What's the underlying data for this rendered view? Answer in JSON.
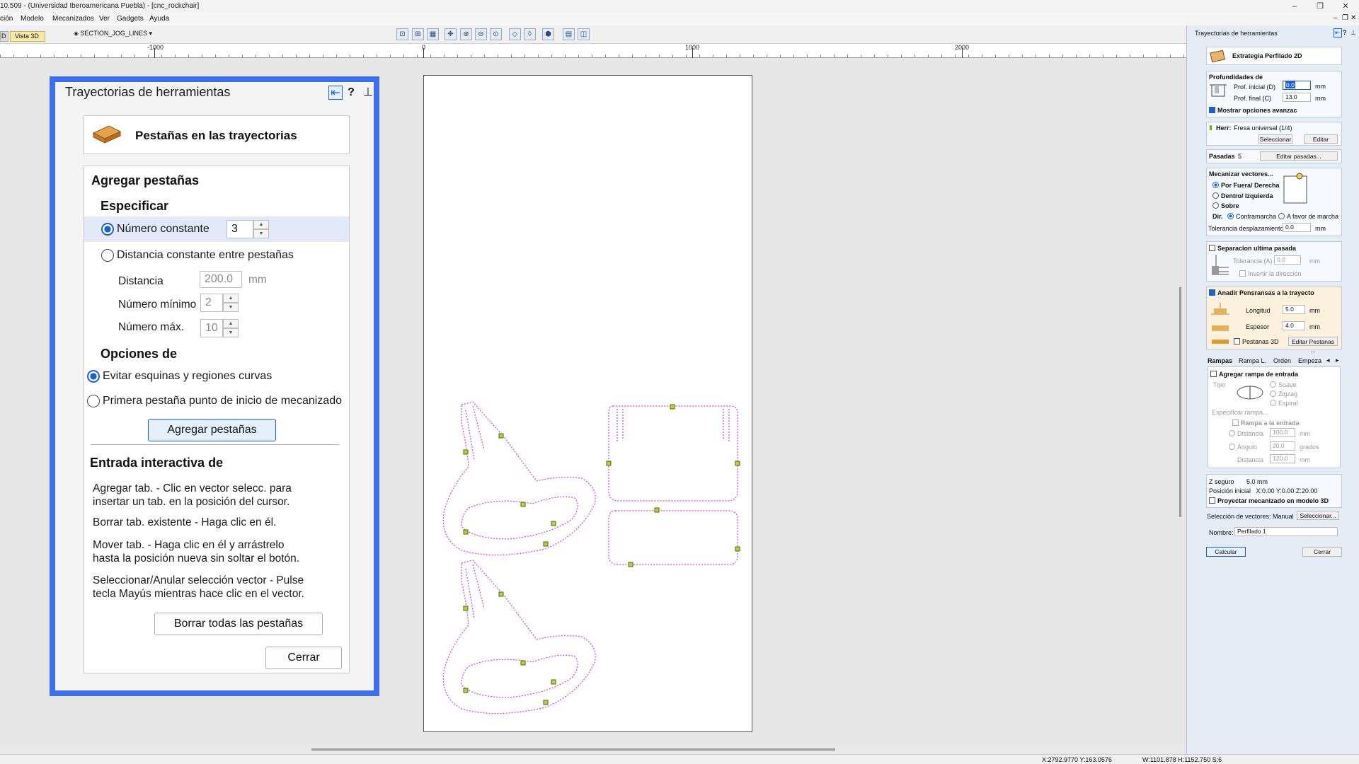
{
  "window": {
    "title": "10.509 - (Universidad Iberoamericana Puebla) - [cnc_rockchair]",
    "controls": [
      "–",
      "❐",
      "✕"
    ],
    "sub_controls": [
      "–",
      "❐",
      "✕"
    ]
  },
  "menu": [
    "ción",
    "Modelo",
    "Mecanizados",
    "Ver",
    "Gadgets",
    "Ayuda"
  ],
  "tabs": {
    "tab_d": "D",
    "vista3d": "Vista 3D"
  },
  "layer": "SECTION_JOG_LINES",
  "ruler": {
    "labels": [
      "-1000",
      "0",
      "1000",
      "2000"
    ]
  },
  "status": {
    "coords": "X:2792.9770 Y:163.0576",
    "dims": "W:1101.878  H:1152.750  S:6"
  },
  "dialog": {
    "title": "Trayectorias de herramientas",
    "header": "Pestañas en las trayectorias",
    "section_add": "Agregar pestañas",
    "specify": "Especificar",
    "opt_constant_number": "Número constante",
    "constant_number_value": "3",
    "opt_constant_distance": "Distancia constante entre pestañas",
    "distance_label": "Distancia",
    "distance_value": "200.0",
    "distance_unit": "mm",
    "min_label": "Número mínimo",
    "min_value": "2",
    "max_label": "Número máx.",
    "max_value": "10",
    "options_title": "Opciones de",
    "opt_avoid": "Evitar esquinas y regiones curvas",
    "opt_first": "Primera pestaña punto de inicio de mecanizado",
    "add_button": "Agregar pestañas",
    "interactive_title": "Entrada interactiva de",
    "help1": "Agregar tab. - Clic en vector selecc. para\ninsertar un tab. en la posición del cursor.",
    "help2": "Borrar tab. existente - Haga clic en él.",
    "help3": "Mover tab. - Haga clic en él y arrástrelo\nhasta la posición nueva sin soltar el botón.",
    "help4": "Seleccionar/Anular selección vector - Pulse\ntecla Mayús mientras hace clic en el vector.",
    "delete_all_button": "Borrar todas las pestañas",
    "close_button": "Cerrar"
  },
  "panel": {
    "title": "Trayectorias de herramientas",
    "strategy": "Extrategia Perfilado 2D",
    "depths_title": "Profundidades de",
    "start_depth_label": "Prof. inicial (D)",
    "start_depth_value": "0.0",
    "end_depth_label": "Prof. final (C)",
    "end_depth_value": "13.0",
    "unit": "mm",
    "show_advanced": "Mostrar opciones avanzac",
    "tool_label": "Herr:",
    "tool_value": "Fresa universal (1/4)",
    "select_btn": "Seleccionar",
    "edit_btn": "Editar",
    "passes_label": "Pasadas",
    "passes_value": "5",
    "edit_passes_btn": "Editar pasadas...",
    "machine_vectors": "Mecanizar vectores...",
    "outside": "Por Fuera/ Derecha",
    "inside": "Dentro/ Izquierda",
    "on": "Sobre",
    "dir_label": "Dir.",
    "climb": "Contramarcha",
    "conventional": "A favor de marcha",
    "offset_tol_label": "Tolerancia desplazamiento",
    "offset_tol_value": "0.0",
    "sep_last_pass": "Separacion ultima pasada",
    "tol_a_label": "Tolerancia (A)",
    "tol_a_value": "0.0",
    "invert_dir": "Invertir la dirección",
    "add_tabs": "Anadir Pensransas a la trayecto",
    "length_label": "Longitud",
    "length_value": "5.0",
    "thickness_label": "Espesor",
    "thickness_value": "4.0",
    "tabs3d": "Pestanas 3D",
    "edit_tabs_btn": "Editar Pestanas ...",
    "subtabs": [
      "Rampas",
      "Rampa L.",
      "Orden",
      "Empeza"
    ],
    "add_ramp": "Agregar rampa de entrada",
    "type_label": "Tipo",
    "smooth": "Suave",
    "zigzag": "Zigzag",
    "spiral": "Espiral",
    "specify_ramp": "Especificar rampa...",
    "ramp_entry": "Rampa a la entrada",
    "ramp_distance_label": "Distancia",
    "ramp_distance_value": "100.0",
    "ramp_angle_label": "Ángulo",
    "ramp_angle_value": "20.0",
    "degrees": "grados",
    "ramp_distance2_label": "Distancia",
    "ramp_distance2_value": "120.0",
    "safe_z": "Z seguro       5.0 mm",
    "home_pos": "Posición inicial   X:0.00 Y:0.00 Z:20.00",
    "project_3d": "Proyectar mecanizado en modelo 3D",
    "vector_sel": "Selección de vectores: Manual",
    "vector_sel_btn": "Seleccionar...",
    "name_label": "Nombre:",
    "name_value": "Perfilado 1",
    "calc_btn": "Calcular",
    "close_btn": "Cerrar"
  },
  "colors": {
    "dialog_border": "#3e6ef0",
    "toolpath": "#d63bd6",
    "tab_marker": "#7da813",
    "accent": "#1a5fd6"
  }
}
